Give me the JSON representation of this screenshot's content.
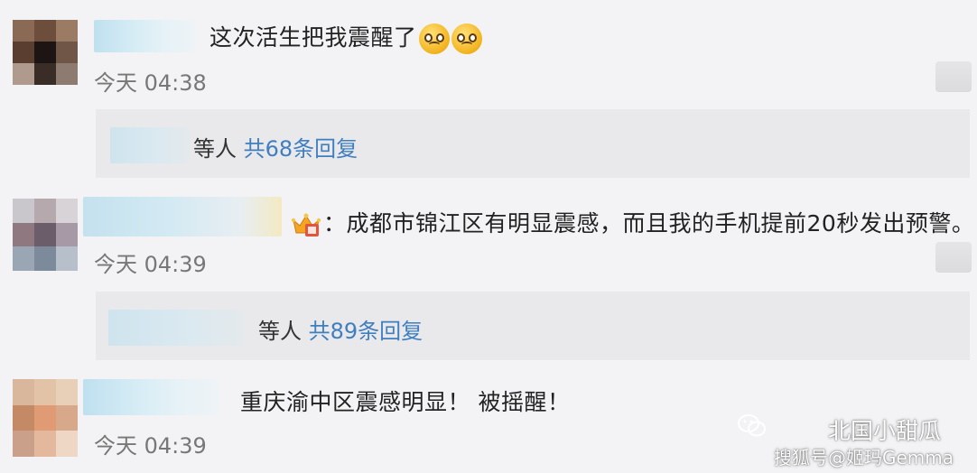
{
  "comments": [
    {
      "text": "这次活生把我震醒了",
      "emojis": [
        "crying-face-emoji",
        "crying-face-emoji"
      ],
      "time": "今天 04:38",
      "reply": {
        "who": "等人",
        "count": "共68条回复"
      }
    },
    {
      "badge_icon": "vip-crown-icon",
      "text": "：成都市锦江区有明显震感，而且我的手机提前20秒发出预警。",
      "time": "今天 04:39",
      "reply": {
        "who": "等人",
        "count": "共89条回复"
      }
    },
    {
      "text": "重庆渝中区震感明显！ 被摇醒！",
      "time": "今天 04:39"
    }
  ],
  "watermark": {
    "line1": "北国小甜瓜",
    "line2": "搜狐号@姬玛Gemma",
    "icon": "wechat-icon"
  },
  "colors": {
    "background": "#f3f3f5",
    "reply_box": "#e9e9ec",
    "reply_count": "#3f7fc0",
    "time_text": "#777777",
    "nickname_blur": "#cfe6f1"
  }
}
